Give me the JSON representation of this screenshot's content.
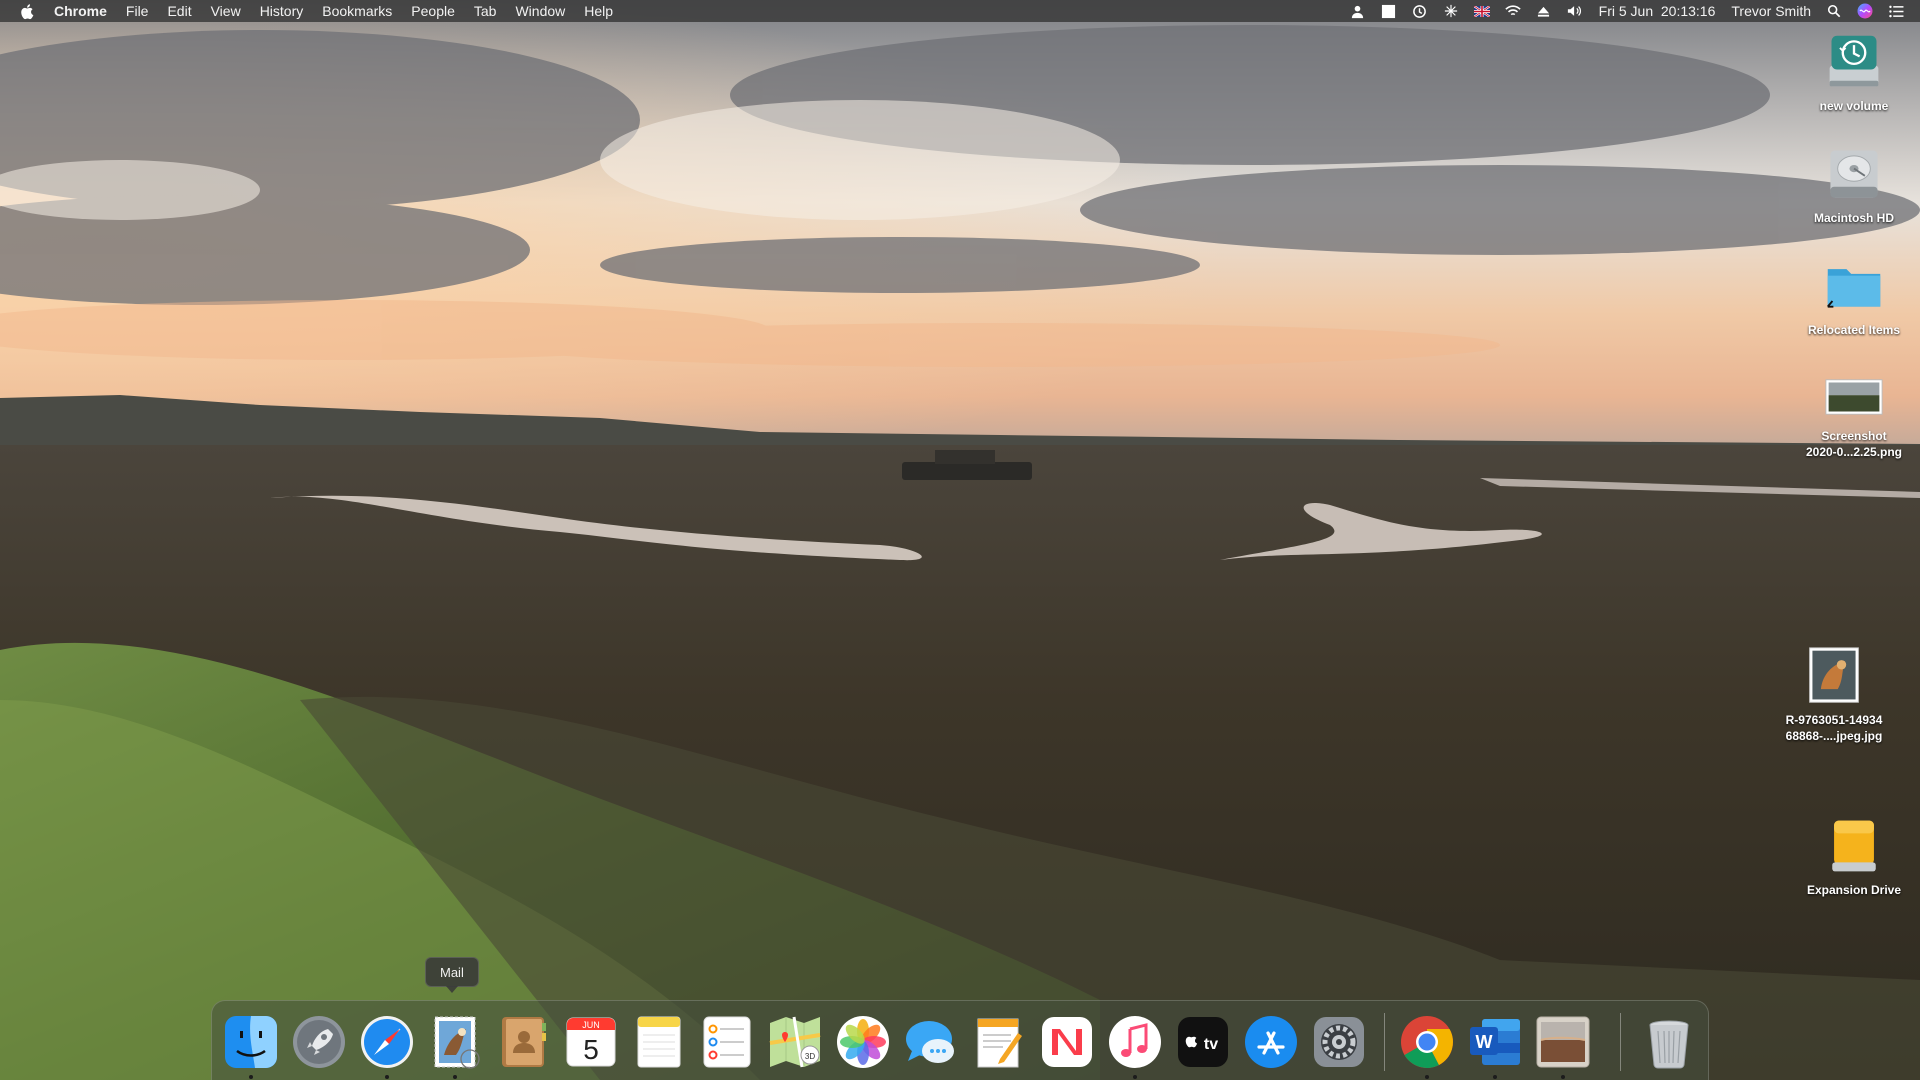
{
  "menubar": {
    "app_name": "Chrome",
    "menus": [
      "File",
      "Edit",
      "View",
      "History",
      "Bookmarks",
      "People",
      "Tab",
      "Window",
      "Help"
    ],
    "status_icons": [
      "user-lock-icon",
      "white-square-icon",
      "time-machine-icon",
      "network-icon",
      "uk-flag-icon",
      "wifi-icon",
      "eject-icon",
      "volume-icon"
    ],
    "clock": "Fri 5 Jun  20:13:16",
    "user": "Trevor Smith"
  },
  "desktop_icons": [
    {
      "label": "new volume",
      "icon": "time-machine-drive-icon"
    },
    {
      "label": "Macintosh HD",
      "icon": "hard-drive-icon"
    },
    {
      "label": "Relocated Items",
      "icon": "folder-alias-icon"
    },
    {
      "label": "Screenshot\n2020-0...2.25.png",
      "icon": "screenshot-thumbnail-icon"
    },
    {
      "label": "R-9763051-14934\n68868-....jpeg.jpg",
      "icon": "image-thumbnail-icon"
    },
    {
      "label": "Expansion Drive",
      "icon": "external-drive-icon"
    }
  ],
  "tooltip": "Mail",
  "dock": {
    "items": [
      {
        "name": "finder",
        "icon": "finder-icon",
        "running": true
      },
      {
        "name": "launchpad",
        "icon": "rocket-icon",
        "running": false
      },
      {
        "name": "safari",
        "icon": "compass-icon",
        "running": true
      },
      {
        "name": "mail",
        "icon": "mail-stamp-icon",
        "running": true
      },
      {
        "name": "contacts",
        "icon": "contacts-book-icon",
        "running": false
      },
      {
        "name": "calendar",
        "icon": "calendar-icon",
        "running": false,
        "month": "JUN",
        "day": "5"
      },
      {
        "name": "notes",
        "icon": "notes-icon",
        "running": false
      },
      {
        "name": "reminders",
        "icon": "reminders-list-icon",
        "running": false
      },
      {
        "name": "maps",
        "icon": "map-icon",
        "running": false
      },
      {
        "name": "photos",
        "icon": "photos-flower-icon",
        "running": false
      },
      {
        "name": "messages",
        "icon": "speech-bubble-icon",
        "running": false
      },
      {
        "name": "pages",
        "icon": "pages-icon",
        "running": false
      },
      {
        "name": "news",
        "icon": "news-icon",
        "running": false
      },
      {
        "name": "music",
        "icon": "music-note-icon",
        "running": true
      },
      {
        "name": "tv",
        "icon": "apple-tv-icon",
        "running": false,
        "text": "tv"
      },
      {
        "name": "app-store",
        "icon": "app-store-icon",
        "running": false
      },
      {
        "name": "system-preferences",
        "icon": "gear-icon",
        "running": false
      },
      {
        "name": "chrome",
        "icon": "chrome-icon",
        "running": true
      },
      {
        "name": "word",
        "icon": "word-icon",
        "running": true,
        "text": "W"
      },
      {
        "name": "preview",
        "icon": "preview-photo-icon",
        "running": true
      },
      {
        "name": "trash",
        "icon": "trash-icon",
        "running": false
      }
    ]
  },
  "colors": {
    "menubar_bg": "#373737",
    "dock_bg": "#464e3e",
    "sky_top": "#8a8a8c",
    "sky_glow": "#f2c9a0",
    "marsh": "#3b352c",
    "grass": "#5e7a3a"
  }
}
